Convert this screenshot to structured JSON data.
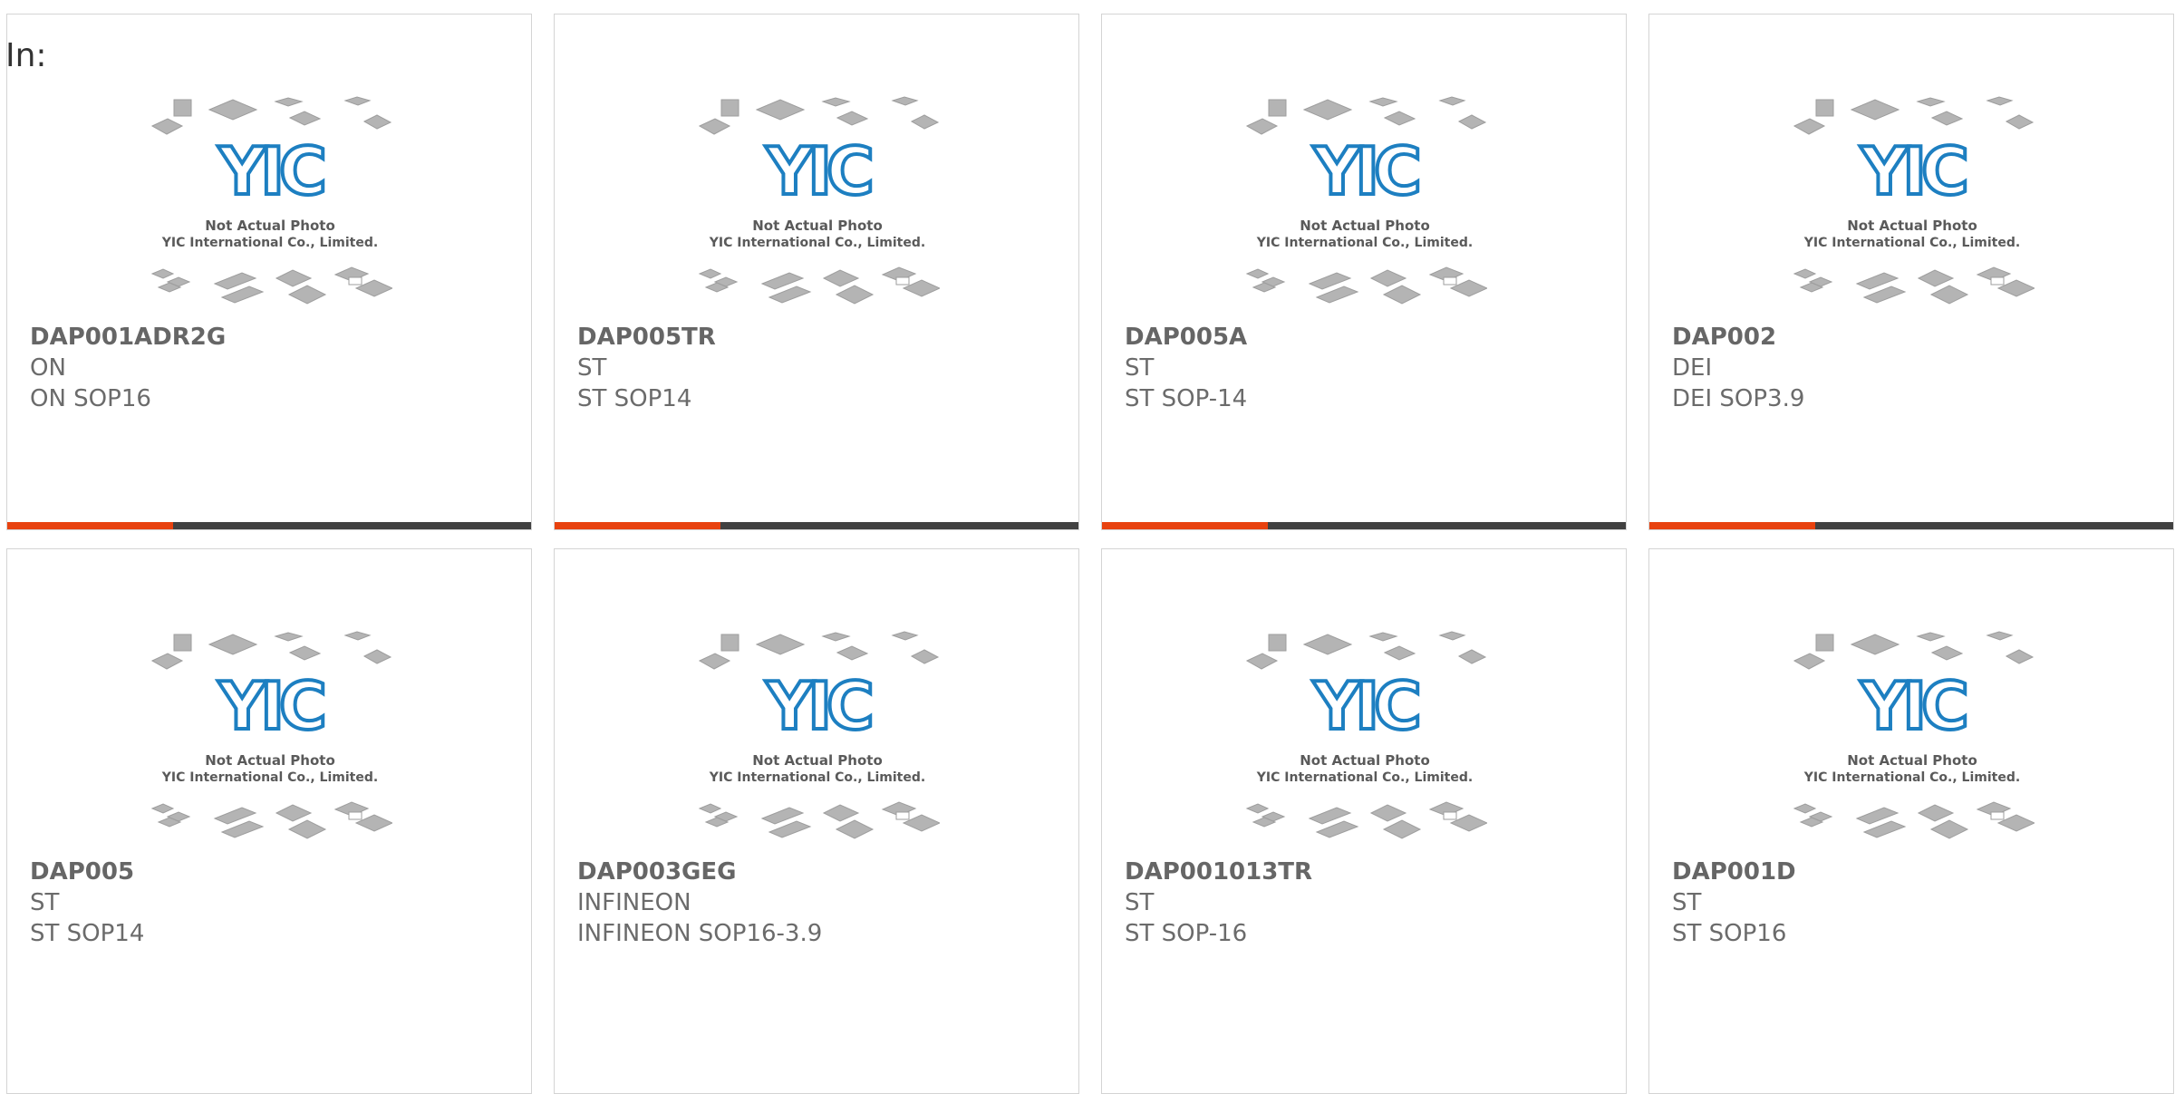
{
  "header": {
    "label": "In:"
  },
  "placeholder": {
    "caption_line1": "Not Actual Photo",
    "caption_line2": "YIC International Co., Limited.",
    "logo_text": "YIC"
  },
  "colors": {
    "accent": "#e8420f",
    "bar": "#414141",
    "logo": "#1d7fc1",
    "chip": "#b4b4b4"
  },
  "products": [
    {
      "part_number": "DAP001ADR2G",
      "manufacturer": "ON",
      "description": "ON SOP16"
    },
    {
      "part_number": "DAP005TR",
      "manufacturer": "ST",
      "description": "ST SOP14"
    },
    {
      "part_number": "DAP005A",
      "manufacturer": "ST",
      "description": "ST SOP-14"
    },
    {
      "part_number": "DAP002",
      "manufacturer": "DEI",
      "description": "DEI SOP3.9"
    },
    {
      "part_number": "DAP005",
      "manufacturer": "ST",
      "description": "ST SOP14"
    },
    {
      "part_number": "DAP003GEG",
      "manufacturer": "INFINEON",
      "description": "INFINEON SOP16-3.9"
    },
    {
      "part_number": "DAP001013TR",
      "manufacturer": "ST",
      "description": "ST SOP-16"
    },
    {
      "part_number": "DAP001D",
      "manufacturer": "ST",
      "description": "ST SOP16"
    }
  ]
}
